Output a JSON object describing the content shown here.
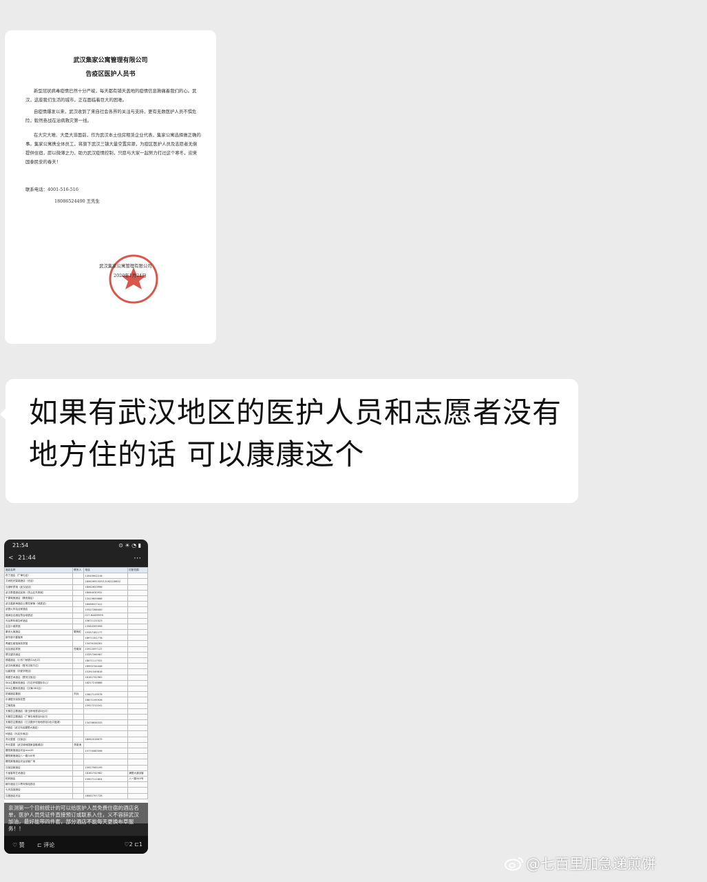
{
  "letter": {
    "org": "武汉集家公寓管理有限公司",
    "title": "告疫区医护人员书",
    "para1": "新型冠状病毒疫情已然十分严峻，每天都有铺天盖地的疫情信息揪痛着我们的心。武汉，这座我们生活的城市，正在面临着巨大的困难。",
    "para2": "自疫情爆发以来，武汉收到了来自社会各界的关注与支持，更有无数医护人员不惧危险，毅然奋战在治病救灾第一线。",
    "para3": "在大灾大难、大是大非面前，作为武汉本土住房租赁企业代表，集家公寓选择做正确的事。集家公寓携全体员工，将旗下武汉三镇大量空置房源，为疫区医护人员及志愿者无偿提供住宿，愿以微薄之力，助力武汉疫情控制，只愿与大家一起努力打过这个寒冬，迎来国泰民安的春天！",
    "contact_label": "联系电话：4001-516-516",
    "contact_2": "18086524490 王先生",
    "sign_org": "武汉集家公寓管理有限公司",
    "sign_date": "2020年1月24日"
  },
  "message": {
    "text": "如果有武汉地区的医护人员和志愿者没有地方住的话 可以康康这个"
  },
  "phone": {
    "status_time": "21:54",
    "status_icons": "⊙ ☀ ◔ ▮",
    "nav_back": "<",
    "nav_title": "21:44",
    "nav_more": "⋯",
    "sheet_header": [
      "酒店名称",
      "联系人",
      "电话",
      "匹配范围"
    ],
    "sheet_rows": [
      [
        "布丁酒店（广埠屯店）",
        "",
        "13545902216",
        ""
      ],
      [
        "艾尚阳光智能酒店（光谷）",
        "",
        "18062691559/13162228652",
        ""
      ],
      [
        "汉缘轩宾馆（武汉站店）",
        "",
        "18062653996",
        ""
      ],
      [
        "武汉泰银酒店民宿（关山区东风城）",
        "",
        "18064030931",
        ""
      ],
      [
        "千喜驾美酒店（静安路店）",
        "",
        "13419609666",
        ""
      ],
      [
        "武汉高新海酒店公寓在家嘛（地铁站）",
        "",
        "18086527411",
        ""
      ],
      [
        "武昌火车站合家酒店",
        "",
        "15527266400",
        ""
      ],
      [
        "福泽百合酒店早台地铁站",
        "",
        "027-84469999",
        ""
      ],
      [
        "光谷青年城空杯酒店",
        "",
        "15671121523",
        ""
      ],
      [
        "吉芸十缘宾馆",
        "",
        "13564395998",
        ""
      ],
      [
        "秦安九美酒店",
        "戴明红",
        "15337161177",
        ""
      ],
      [
        "新华新兴春客房",
        "",
        "18971351776",
        ""
      ],
      [
        "青藏玉客馆商务宾馆",
        "",
        "13476156281",
        ""
      ],
      [
        "佳友酒店宾馆",
        "任曦凤",
        "15922097127",
        ""
      ],
      [
        "楚汉望亦酒店",
        "",
        "15337264987",
        ""
      ],
      [
        "德嘉酒店（小东门地铁口A出口）",
        "",
        "18071117531",
        ""
      ],
      [
        "武汉尚美酒店（登河汉街万达）",
        "",
        "18995744446",
        ""
      ],
      [
        "仙豪宾馆（华夏学院店）",
        "",
        "15391549818",
        ""
      ],
      [
        "简爱艺术酒店（楚河汉街店）",
        "",
        "18162742982",
        ""
      ],
      [
        "SKA主题商务酒店（万达环球国际中心）",
        "",
        "18217218888",
        ""
      ],
      [
        "SKA主题商务酒店（汉海CBD店）",
        "",
        "",
        ""
      ],
      [
        "铂澜酒店集团",
        "刘兵",
        "15807119576",
        ""
      ],
      [
        "乐湖堡天街探花里",
        "",
        "18871195926",
        ""
      ],
      [
        "兰陵苑舍",
        "",
        "15927212241",
        ""
      ],
      [
        "天鹅恋主题酒店（新玉桥地铁站D出口）",
        "",
        "",
        ""
      ],
      [
        "天鹅恋主题酒店（广埠屯地铁站A出口）",
        "",
        "",
        ""
      ],
      [
        "天鹅恋主题酒店（江汉路步行街地铁站D出口蓝湖）",
        "",
        "13476656333",
        ""
      ],
      [
        "M酒店（武汉光谷捷楚大酒店）",
        "",
        "",
        ""
      ],
      [
        "M酒店（光谷天地店）",
        "",
        "",
        ""
      ],
      [
        "乔元童居（汉街店）",
        "",
        "18062018679",
        ""
      ],
      [
        "乔元童居（武汉绿地国家金融城店）",
        "李夏涛",
        "",
        ""
      ],
      [
        "樱悦美宿酒店光谷mss39",
        "",
        "15770080596",
        ""
      ],
      [
        "樱悦美宿酒店八一路340号",
        "",
        "",
        ""
      ],
      [
        "樱悦美宿酒店光谷创客广场",
        "",
        "",
        ""
      ],
      [
        "汉街如家酒店",
        "",
        "15927565199",
        ""
      ],
      [
        "卡途客啡艺术酒店",
        "",
        "18162742982",
        "满楚大道创客"
      ],
      [
        "柏林酒店",
        "",
        "15907111804",
        "八一路340号"
      ],
      [
        "格尔酒店江口青年驿站铁店",
        "",
        "",
        ""
      ],
      [
        "七天连锁酒店",
        "",
        "",
        ""
      ],
      [
        "汉庭酒店光谷",
        "",
        "18062797728",
        ""
      ]
    ],
    "overlay_text": "亲测第一个目前统计的可以给医护人员免费住宿的酒店名单，医护人员凭证件直接预订或联系入住，义不容辞武汉加油，最好能带四件套，部分酒店不能每天更换布草服务！！",
    "action_like": "♡ 赞",
    "action_comment": "⊏ 评论",
    "action_count": "♡2 ⊏1"
  },
  "watermark": {
    "text": "@七百里加急递煎饼"
  },
  "colors": {
    "background": "#ebebeb",
    "bubble": "#ffffff",
    "seal_red": "#d23a2a"
  }
}
